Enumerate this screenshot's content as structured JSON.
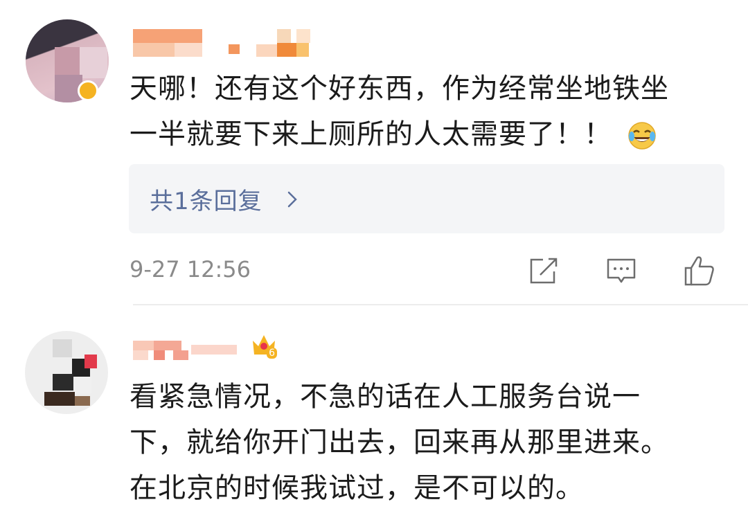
{
  "comments": [
    {
      "author_name": "",
      "text_line1": "天哪！还有这个好东西，作为经常坐地铁坐",
      "text_line2": "一半就要下来上厕所的人太需要了！！",
      "emoji": "laughing-tears-emoji",
      "reply_link": "共1条回复",
      "timestamp": "9-27 12:56",
      "actions": [
        "share-icon",
        "comment-icon",
        "like-icon"
      ]
    },
    {
      "author_name": "",
      "level_badge": "6",
      "text_line1": "看紧急情况，不急的话在人工服务台说一",
      "text_line2": "下，就给你开门出去，回来再从那里进来。",
      "text_line3": "在北京的时候我试过，是不可以的。"
    }
  ],
  "colors": {
    "reply_link": "#5a6e9b",
    "timestamp": "#8a8a8a",
    "reply_bg": "#f4f5f7",
    "badge": "#f5b322"
  }
}
